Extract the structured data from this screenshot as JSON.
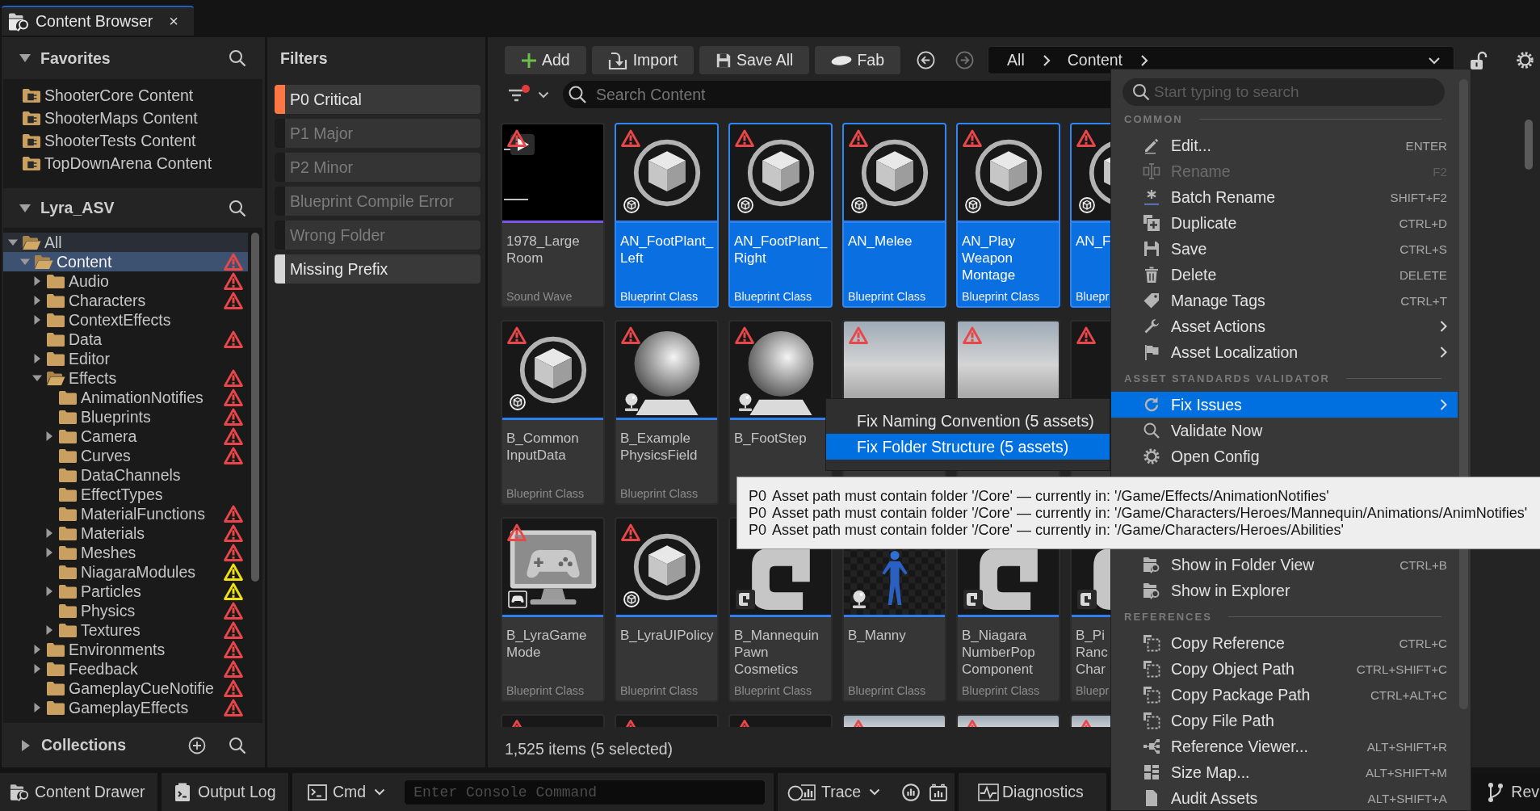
{
  "tab": {
    "title": "Content Browser",
    "close": "×"
  },
  "favorites": {
    "title": "Favorites",
    "items": [
      "ShooterCore Content",
      "ShooterMaps Content",
      "ShooterTests Content",
      "TopDownArena Content"
    ]
  },
  "tree": {
    "title": "Lyra_ASV",
    "items": [
      {
        "label": "All",
        "expandable": true,
        "expanded": true,
        "selected": false,
        "children": [
          {
            "label": "Content",
            "expandable": true,
            "expanded": true,
            "selected": true,
            "color": "#e8474a",
            "children": [
              {
                "label": "Audio",
                "expandable": true,
                "expanded": false,
                "selected": false,
                "color": "#e8474a"
              },
              {
                "label": "Characters",
                "expandable": true,
                "expanded": false,
                "selected": false,
                "color": "#e8474a"
              },
              {
                "label": "ContextEffects",
                "expandable": true,
                "expanded": false,
                "selected": false
              },
              {
                "label": "Data",
                "expandable": false,
                "expanded": false,
                "selected": false,
                "color": "#e8474a"
              },
              {
                "label": "Editor",
                "expandable": true,
                "expanded": false,
                "selected": false
              },
              {
                "label": "Effects",
                "expandable": true,
                "expanded": true,
                "selected": false,
                "color": "#e8474a",
                "children": [
                  {
                    "label": "AnimationNotifies",
                    "expandable": false,
                    "expanded": false,
                    "selected": false,
                    "color": "#e8474a"
                  },
                  {
                    "label": "Blueprints",
                    "expandable": false,
                    "expanded": false,
                    "selected": false,
                    "color": "#e8474a"
                  },
                  {
                    "label": "Camera",
                    "expandable": true,
                    "expanded": false,
                    "selected": false,
                    "color": "#e8474a"
                  },
                  {
                    "label": "Curves",
                    "expandable": false,
                    "expanded": false,
                    "selected": false,
                    "color": "#e8474a"
                  },
                  {
                    "label": "DataChannels",
                    "expandable": false,
                    "expanded": false,
                    "selected": false
                  },
                  {
                    "label": "EffectTypes",
                    "expandable": false,
                    "expanded": false,
                    "selected": false
                  },
                  {
                    "label": "MaterialFunctions",
                    "expandable": false,
                    "expanded": false,
                    "selected": false,
                    "color": "#e8474a"
                  },
                  {
                    "label": "Materials",
                    "expandable": true,
                    "expanded": false,
                    "selected": false,
                    "color": "#e8474a"
                  },
                  {
                    "label": "Meshes",
                    "expandable": true,
                    "expanded": false,
                    "selected": false,
                    "color": "#e8474a"
                  },
                  {
                    "label": "NiagaraModules",
                    "expandable": false,
                    "expanded": false,
                    "selected": false,
                    "color": "#f0e010"
                  },
                  {
                    "label": "Particles",
                    "expandable": true,
                    "expanded": false,
                    "selected": false,
                    "color": "#f0e010"
                  },
                  {
                    "label": "Physics",
                    "expandable": false,
                    "expanded": false,
                    "selected": false,
                    "color": "#e8474a"
                  },
                  {
                    "label": "Textures",
                    "expandable": true,
                    "expanded": false,
                    "selected": false,
                    "color": "#e8474a"
                  }
                ]
              },
              {
                "label": "Environments",
                "expandable": true,
                "expanded": false,
                "selected": false,
                "color": "#e8474a"
              },
              {
                "label": "Feedback",
                "expandable": true,
                "expanded": false,
                "selected": false,
                "color": "#e8474a"
              },
              {
                "label": "GameplayCueNotifie",
                "expandable": false,
                "expanded": false,
                "selected": false,
                "color": "#e8474a"
              },
              {
                "label": "GameplayEffects",
                "expandable": true,
                "expanded": false,
                "selected": false,
                "color": "#e8474a"
              }
            ]
          }
        ]
      }
    ]
  },
  "collections": {
    "title": "Collections"
  },
  "filters": {
    "title": "Filters",
    "items": [
      {
        "label": "P0 Critical",
        "on": true,
        "color": "#ff7645"
      },
      {
        "label": "P1 Major",
        "on": false
      },
      {
        "label": "P2 Minor",
        "on": false
      },
      {
        "label": "Blueprint Compile Error",
        "on": false
      },
      {
        "label": "Wrong Folder",
        "on": false
      },
      {
        "label": "Missing Prefix",
        "on": true,
        "color": "#d6d6d6"
      }
    ]
  },
  "toolbar": {
    "buttons": [
      {
        "kind": "add",
        "label": "Add"
      },
      {
        "kind": "import",
        "label": "Import"
      },
      {
        "kind": "save",
        "label": "Save All"
      },
      {
        "kind": "fab",
        "label": "Fab"
      }
    ],
    "nav": [
      {
        "kind": "back",
        "disabled": false
      },
      {
        "kind": "forward",
        "disabled": true
      }
    ],
    "path": [
      "All",
      "Content"
    ]
  },
  "search": {
    "placeholder": "Search Content"
  },
  "asset_rows": [
    [
      {
        "kind": "sound",
        "color": "#7a55e6",
        "warning": true,
        "selected": false,
        "name": [
          "1978_Large",
          "Room"
        ],
        "type": "Sound Wave"
      },
      {
        "kind": "cube",
        "color": "#2d7ff0",
        "warning": true,
        "selected": true,
        "name": [
          "AN_FootPlant_",
          "Left"
        ],
        "type": "Blueprint Class"
      },
      {
        "kind": "cube",
        "color": "#2d7ff0",
        "warning": true,
        "selected": true,
        "name": [
          "AN_FootPlant_",
          "Right"
        ],
        "type": "Blueprint Class"
      },
      {
        "kind": "cube",
        "color": "#2d7ff0",
        "warning": true,
        "selected": true,
        "name": [
          "AN_Melee"
        ],
        "type": "Blueprint Class"
      },
      {
        "kind": "cube",
        "color": "#2d7ff0",
        "warning": true,
        "selected": true,
        "name": [
          "AN_Play",
          "Weapon",
          "Montage"
        ],
        "type": "Blueprint Class"
      },
      {
        "kind": "cube",
        "color": "#2d7ff0",
        "warning": true,
        "selected": true,
        "name": [
          "AN_F"
        ],
        "type": "Bluepr"
      }
    ],
    [
      {
        "kind": "cube",
        "color": "#2d7ff0",
        "warning": true,
        "selected": false,
        "name": [
          "B_Common",
          "InputData"
        ],
        "type": "Blueprint Class"
      },
      {
        "kind": "sphere",
        "color": "#2d7ff0",
        "warning": true,
        "selected": false,
        "name": [
          "B_Example",
          "PhysicsField"
        ],
        "type": "Blueprint Class"
      },
      {
        "kind": "sphere",
        "color": "#2d7ff0",
        "warning": true,
        "selected": false,
        "name": [
          "B_FootStep"
        ]
      },
      {
        "kind": "photo",
        "warning": true,
        "selected": false
      },
      {
        "kind": "photo",
        "warning": true,
        "selected": false
      },
      {
        "kind": "blank",
        "warning": true,
        "selected": false
      }
    ],
    [
      {
        "kind": "gamepad",
        "color": "#2d7ff0",
        "warning": true,
        "selected": false,
        "name": [
          "B_LyraGame",
          "Mode"
        ],
        "type": "Blueprint Class"
      },
      {
        "kind": "cube",
        "color": "#2d7ff0",
        "warning": true,
        "selected": false,
        "name": [
          "B_LyraUIPolicy"
        ],
        "type": "Blueprint Class"
      },
      {
        "kind": "class",
        "color": "#2d7ff0",
        "selected": false,
        "name": [
          "B_Mannequin",
          "Pawn",
          "Cosmetics"
        ],
        "type": "Blueprint Class"
      },
      {
        "kind": "figure",
        "color": "#2d7ff0",
        "selected": false,
        "name": [
          "B_Manny"
        ],
        "type": "Blueprint Class"
      },
      {
        "kind": "class",
        "color": "#2d7ff0",
        "selected": false,
        "name": [
          "B_Niagara",
          "NumberPop",
          "Component"
        ],
        "type": "Blueprint Class"
      },
      {
        "kind": "class",
        "color": "#2d7ff0",
        "selected": false,
        "name": [
          "B_Pi",
          "Ranc",
          "Char"
        ],
        "type": "Bluepr"
      }
    ]
  ],
  "next_row": [
    {
      "kind": "blank",
      "warning": true
    },
    {
      "kind": "blank",
      "warning": true
    },
    {
      "kind": "blank",
      "warning": true
    },
    {
      "kind": "photo",
      "warning": true
    },
    {
      "kind": "photo",
      "warning": true
    },
    {
      "kind": "photo",
      "warning": true
    }
  ],
  "status": "1,525 items (5 selected)",
  "context_menu": {
    "search_placeholder": "Start typing to search",
    "sections": [
      {
        "title": "COMMON",
        "items": [
          {
            "kind": "edit",
            "label": "Edit...",
            "shortcut": "ENTER",
            "disabled": false,
            "selected": false,
            "submenu": false
          },
          {
            "kind": "rename",
            "label": "Rename",
            "shortcut": "F2",
            "disabled": true,
            "selected": false,
            "submenu": false
          },
          {
            "kind": "batch",
            "label": "Batch Rename",
            "shortcut": "SHIFT+F2",
            "disabled": false,
            "selected": false,
            "submenu": false
          },
          {
            "kind": "duplicate",
            "label": "Duplicate",
            "shortcut": "CTRL+D",
            "disabled": false,
            "selected": false,
            "submenu": false
          },
          {
            "kind": "save",
            "label": "Save",
            "shortcut": "CTRL+S",
            "disabled": false,
            "selected": false,
            "submenu": false
          },
          {
            "kind": "delete",
            "label": "Delete",
            "shortcut": "DELETE",
            "disabled": false,
            "selected": false,
            "submenu": false
          },
          {
            "kind": "tags",
            "label": "Manage Tags",
            "shortcut": "CTRL+T",
            "disabled": false,
            "selected": false,
            "submenu": false
          },
          {
            "kind": "actions",
            "label": "Asset Actions",
            "disabled": false,
            "selected": false,
            "submenu": true
          },
          {
            "kind": "localization",
            "label": "Asset Localization",
            "disabled": false,
            "selected": false,
            "submenu": true
          }
        ]
      },
      {
        "title": "ASSET STANDARDS VALIDATOR",
        "items": [
          {
            "kind": "fix",
            "label": "Fix Issues",
            "disabled": false,
            "selected": true,
            "submenu": true
          },
          {
            "kind": "validate",
            "label": "Validate Now",
            "disabled": false,
            "selected": false,
            "submenu": false
          },
          {
            "kind": "config",
            "label": "Open Config",
            "disabled": false,
            "selected": false,
            "submenu": false
          }
        ]
      },
      {
        "items": [
          {
            "kind": "folder",
            "label": "Show in Folder View",
            "shortcut": "CTRL+B",
            "disabled": false,
            "selected": false,
            "submenu": false
          },
          {
            "kind": "explorer",
            "label": "Show in Explorer",
            "disabled": false,
            "selected": false,
            "submenu": false
          }
        ]
      },
      {
        "title": "REFERENCES",
        "items": [
          {
            "kind": "copy",
            "label": "Copy Reference",
            "shortcut": "CTRL+C",
            "disabled": false,
            "selected": false,
            "submenu": false
          },
          {
            "kind": "copy",
            "label": "Copy Object Path",
            "shortcut": "CTRL+SHIFT+C",
            "disabled": false,
            "selected": false,
            "submenu": false
          },
          {
            "kind": "copy",
            "label": "Copy Package Path",
            "shortcut": "CTRL+ALT+C",
            "disabled": false,
            "selected": false,
            "submenu": false
          },
          {
            "kind": "copy",
            "label": "Copy File Path",
            "disabled": false,
            "selected": false,
            "submenu": false
          },
          {
            "kind": "viewer",
            "label": "Reference Viewer...",
            "shortcut": "ALT+SHIFT+R",
            "disabled": false,
            "selected": false,
            "submenu": false
          },
          {
            "kind": "sizemap",
            "label": "Size Map...",
            "shortcut": "ALT+SHIFT+M",
            "disabled": false,
            "selected": false,
            "submenu": false
          },
          {
            "kind": "audit",
            "label": "Audit Assets",
            "shortcut": "ALT+SHIFT+A",
            "disabled": false,
            "selected": false,
            "submenu": false
          }
        ]
      }
    ]
  },
  "submenu": [
    {
      "label": "Fix Naming Convention (5 assets)",
      "selected": false
    },
    {
      "label": "Fix Folder Structure (5 assets)",
      "selected": true
    }
  ],
  "tooltip": [
    {
      "severity": "P0",
      "text": "Asset path must contain folder '/Core' — currently in: '/Game/Effects/AnimationNotifies'"
    },
    {
      "severity": "P0",
      "text": "Asset path must contain folder '/Core' — currently in: '/Game/Characters/Heroes/Mannequin/Animations/AnimNotifies'"
    },
    {
      "severity": "P0",
      "text": "Asset path must contain folder '/Core' — currently in: '/Game/Characters/Heroes/Abilities'"
    }
  ],
  "bottom_bar": {
    "content_drawer": "Content Drawer",
    "output_log": "Output Log",
    "cmd": "Cmd",
    "console_placeholder": "Enter Console Command",
    "trace": "Trace",
    "diagnostics": "Diagnostics",
    "revision": "Rev"
  }
}
